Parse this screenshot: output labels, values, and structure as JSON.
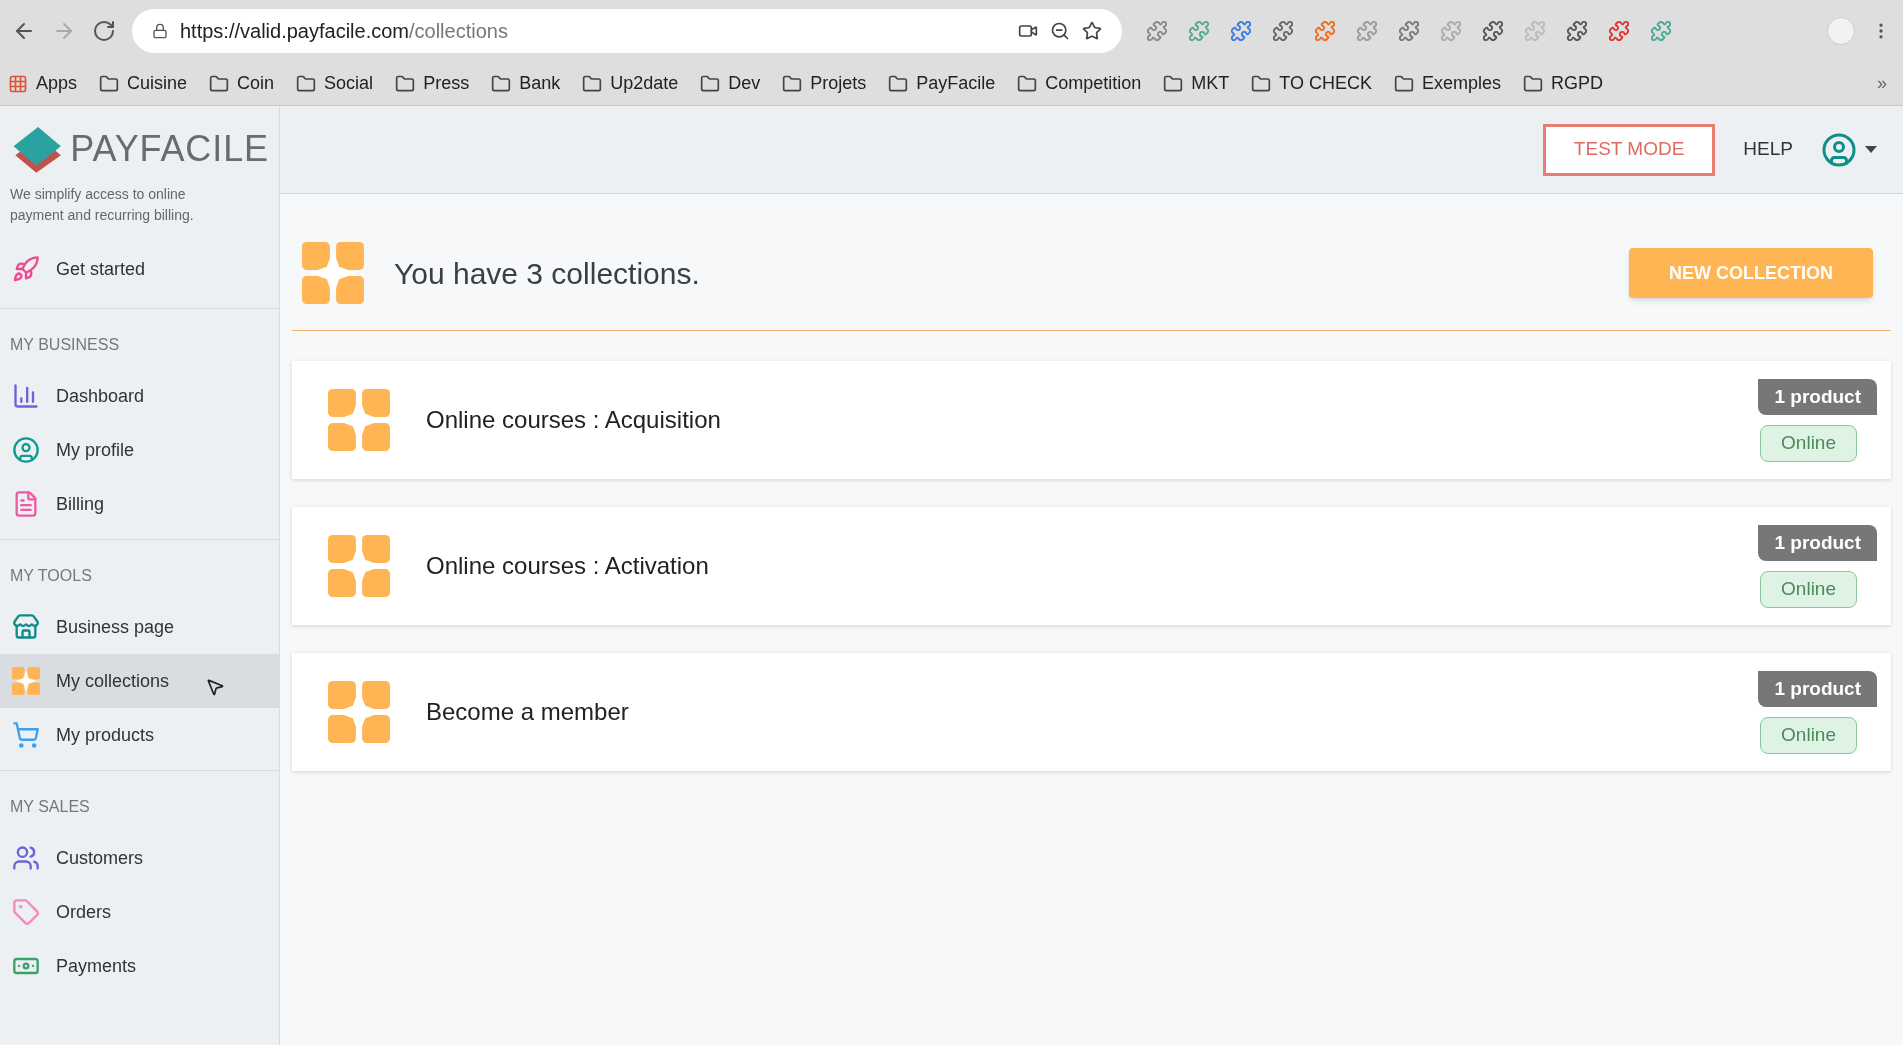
{
  "browser": {
    "url_host": "https://valid.payfacile.com",
    "url_path": "/collections",
    "bookmarks": [
      {
        "label": "Apps",
        "kind": "apps"
      },
      {
        "label": "Cuisine",
        "kind": "folder"
      },
      {
        "label": "Coin",
        "kind": "folder"
      },
      {
        "label": "Social",
        "kind": "folder"
      },
      {
        "label": "Press",
        "kind": "folder"
      },
      {
        "label": "Bank",
        "kind": "folder"
      },
      {
        "label": "Up2date",
        "kind": "folder"
      },
      {
        "label": "Dev",
        "kind": "folder"
      },
      {
        "label": "Projets",
        "kind": "folder"
      },
      {
        "label": "PayFacile",
        "kind": "folder"
      },
      {
        "label": "Competition",
        "kind": "folder"
      },
      {
        "label": "MKT",
        "kind": "folder"
      },
      {
        "label": "TO CHECK",
        "kind": "folder"
      },
      {
        "label": "Exemples",
        "kind": "folder"
      },
      {
        "label": "RGPD",
        "kind": "folder"
      }
    ],
    "more": "»"
  },
  "sidebar": {
    "logo": "PAYFACILE",
    "tagline": "We simplify access to online payment and recurring billing.",
    "sections": [
      {
        "items": [
          {
            "label": "Get started",
            "selected": false
          }
        ]
      },
      {
        "title": "MY BUSINESS",
        "items": [
          {
            "label": "Dashboard",
            "selected": false
          },
          {
            "label": "My profile",
            "selected": false
          },
          {
            "label": "Billing",
            "selected": false
          }
        ]
      },
      {
        "title": "MY TOOLS",
        "items": [
          {
            "label": "Business page",
            "selected": false
          },
          {
            "label": "My collections",
            "selected": true
          },
          {
            "label": "My products",
            "selected": false
          }
        ]
      },
      {
        "title": "MY SALES",
        "items": [
          {
            "label": "Customers",
            "selected": false
          },
          {
            "label": "Orders",
            "selected": false
          },
          {
            "label": "Payments",
            "selected": false
          }
        ]
      }
    ]
  },
  "header": {
    "test_mode": "TEST MODE",
    "help": "HELP"
  },
  "page": {
    "heading": "You have 3 collections.",
    "new_button": "NEW COLLECTION"
  },
  "collections": [
    {
      "name": "Online courses : Acquisition",
      "products": "1 product",
      "status": "Online"
    },
    {
      "name": "Online courses : Activation",
      "products": "1 product",
      "status": "Online"
    },
    {
      "name": "Become a member",
      "products": "1 product",
      "status": "Online"
    }
  ]
}
